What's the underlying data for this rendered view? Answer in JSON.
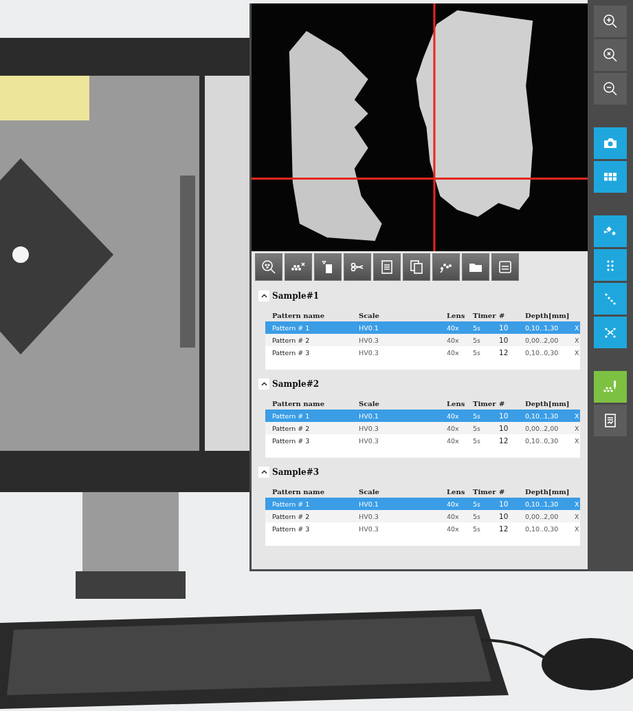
{
  "toolbar": [
    {
      "kind": "zoom-points"
    },
    {
      "kind": "add-points"
    },
    {
      "kind": "delete"
    },
    {
      "kind": "cut"
    },
    {
      "kind": "document"
    },
    {
      "kind": "copy"
    },
    {
      "kind": "points"
    },
    {
      "kind": "folder"
    },
    {
      "kind": "save"
    }
  ],
  "samples": [
    {
      "title": "Sample#1",
      "expanded": true,
      "columns": [
        "Pattern name",
        "Scale",
        "Lens",
        "Timer",
        "#",
        "Depth[mm]"
      ],
      "rows": [
        {
          "cells": [
            "Pattern # 1",
            "HV0.1",
            "40x",
            "5s",
            "10",
            "0,10..1,30",
            "X"
          ],
          "selected": true
        },
        {
          "cells": [
            "Pattern # 2",
            "HV0.3",
            "40x",
            "5s",
            "10",
            "0,00..2,00",
            "X"
          ],
          "selected": false
        },
        {
          "cells": [
            "Pattern # 3",
            "HV0.3",
            "40x",
            "5s",
            "12",
            "0,10..0,30",
            "X"
          ],
          "selected": false
        }
      ]
    },
    {
      "title": "Sample#2",
      "expanded": true,
      "columns": [
        "Pattern name",
        "Scale",
        "Lens",
        "Timer",
        "#",
        "Depth[mm]"
      ],
      "rows": [
        {
          "cells": [
            "Pattern # 1",
            "HV0.1",
            "40x",
            "5s",
            "10",
            "0,10..1,30",
            "X"
          ],
          "selected": true
        },
        {
          "cells": [
            "Pattern # 2",
            "HV0.3",
            "40x",
            "5s",
            "10",
            "0,00..2,00",
            "X"
          ],
          "selected": false
        },
        {
          "cells": [
            "Pattern # 3",
            "HV0.3",
            "40x",
            "5s",
            "12",
            "0,10..0,30",
            "X"
          ],
          "selected": false
        }
      ]
    },
    {
      "title": "Sample#3",
      "expanded": true,
      "columns": [
        "Pattern name",
        "Scale",
        "Lens",
        "Timer",
        "#",
        "Depth[mm]"
      ],
      "rows": [
        {
          "cells": [
            "Pattern # 1",
            "HV0.1",
            "40x",
            "5s",
            "10",
            "0,10..1,30",
            "X"
          ],
          "selected": true
        },
        {
          "cells": [
            "Pattern # 2",
            "HV0.3",
            "40x",
            "5s",
            "10",
            "0,00..2,00",
            "X"
          ],
          "selected": false
        },
        {
          "cells": [
            "Pattern # 3",
            "HV0.3",
            "40x",
            "5s",
            "12",
            "0,10..0,30",
            "X"
          ],
          "selected": false
        }
      ]
    }
  ],
  "side_toolbar": [
    {
      "kind": "zoom-in",
      "color": "#5c5c5c"
    },
    {
      "kind": "zoom-reset",
      "color": "#5c5c5c"
    },
    {
      "kind": "zoom-out",
      "color": "#5c5c5c"
    },
    {
      "kind": "gap"
    },
    {
      "kind": "camera",
      "color": "#1fa7dd"
    },
    {
      "kind": "grid",
      "color": "#1fa7dd"
    },
    {
      "kind": "gap"
    },
    {
      "kind": "pattern-single",
      "color": "#1fa7dd"
    },
    {
      "kind": "pattern-grid",
      "color": "#1fa7dd"
    },
    {
      "kind": "pattern-line",
      "color": "#1fa7dd"
    },
    {
      "kind": "pattern-cross",
      "color": "#1fa7dd"
    },
    {
      "kind": "gap"
    },
    {
      "kind": "indent",
      "color": "#7dc142"
    },
    {
      "kind": "report",
      "color": "#5c5c5c"
    }
  ]
}
